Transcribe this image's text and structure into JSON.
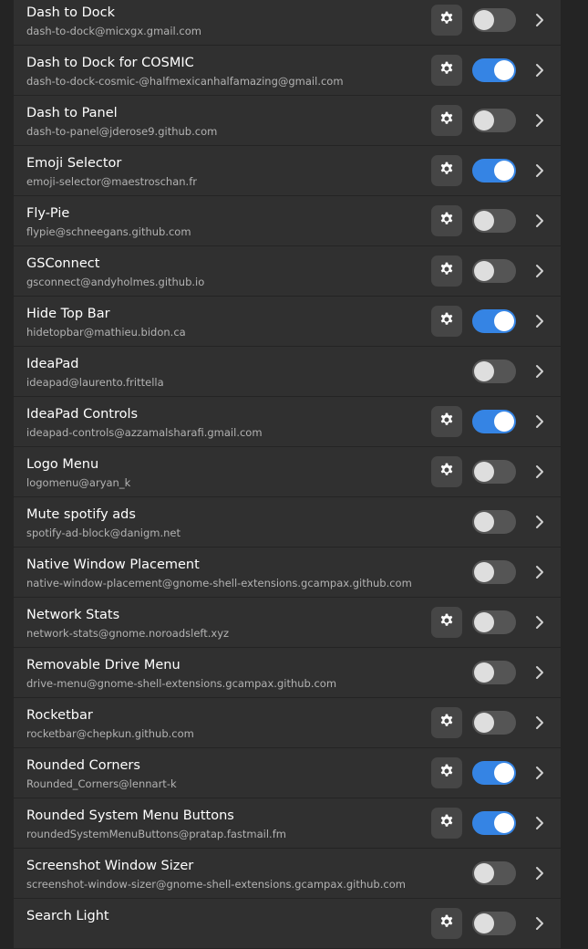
{
  "extensions": [
    {
      "name": "Dash to Dock",
      "uuid": "dash-to-dock@micxgx.gmail.com",
      "has_settings": true,
      "enabled": false
    },
    {
      "name": "Dash to Dock for COSMIC",
      "uuid": "dash-to-dock-cosmic-@halfmexicanhalfamazing@gmail.com",
      "has_settings": true,
      "enabled": true
    },
    {
      "name": "Dash to Panel",
      "uuid": "dash-to-panel@jderose9.github.com",
      "has_settings": true,
      "enabled": false
    },
    {
      "name": "Emoji Selector",
      "uuid": "emoji-selector@maestroschan.fr",
      "has_settings": true,
      "enabled": true
    },
    {
      "name": "Fly-Pie",
      "uuid": "flypie@schneegans.github.com",
      "has_settings": true,
      "enabled": false
    },
    {
      "name": "GSConnect",
      "uuid": "gsconnect@andyholmes.github.io",
      "has_settings": true,
      "enabled": false
    },
    {
      "name": "Hide Top Bar",
      "uuid": "hidetopbar@mathieu.bidon.ca",
      "has_settings": true,
      "enabled": true
    },
    {
      "name": "IdeaPad",
      "uuid": "ideapad@laurento.frittella",
      "has_settings": false,
      "enabled": false
    },
    {
      "name": "IdeaPad Controls",
      "uuid": "ideapad-controls@azzamalsharafi.gmail.com",
      "has_settings": true,
      "enabled": true
    },
    {
      "name": "Logo Menu",
      "uuid": "logomenu@aryan_k",
      "has_settings": true,
      "enabled": false
    },
    {
      "name": "Mute spotify ads",
      "uuid": "spotify-ad-block@danigm.net",
      "has_settings": false,
      "enabled": false
    },
    {
      "name": "Native Window Placement",
      "uuid": "native-window-placement@gnome-shell-extensions.gcampax.github.com",
      "has_settings": false,
      "enabled": false
    },
    {
      "name": "Network Stats",
      "uuid": "network-stats@gnome.noroadsleft.xyz",
      "has_settings": true,
      "enabled": false
    },
    {
      "name": "Removable Drive Menu",
      "uuid": "drive-menu@gnome-shell-extensions.gcampax.github.com",
      "has_settings": false,
      "enabled": false
    },
    {
      "name": "Rocketbar",
      "uuid": "rocketbar@chepkun.github.com",
      "has_settings": true,
      "enabled": false
    },
    {
      "name": "Rounded Corners",
      "uuid": "Rounded_Corners@lennart-k",
      "has_settings": true,
      "enabled": true
    },
    {
      "name": "Rounded System Menu Buttons",
      "uuid": "roundedSystemMenuButtons@pratap.fastmail.fm",
      "has_settings": true,
      "enabled": true
    },
    {
      "name": "Screenshot Window Sizer",
      "uuid": "screenshot-window-sizer@gnome-shell-extensions.gcampax.github.com",
      "has_settings": false,
      "enabled": false
    },
    {
      "name": "Search Light",
      "uuid": "",
      "has_settings": true,
      "enabled": false
    }
  ],
  "icons": {
    "settings": "gear-icon",
    "details": "chevron-right-icon"
  },
  "colors": {
    "accent": "#3584e4",
    "row_background": "#303030",
    "window_background": "#242424"
  }
}
